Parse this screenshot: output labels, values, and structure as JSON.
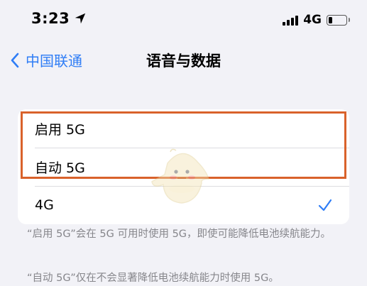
{
  "status_bar": {
    "time": "3:23",
    "network": "4G",
    "icons": [
      "location-arrow-icon",
      "cellular-signal-icon",
      "battery-icon"
    ]
  },
  "nav": {
    "back_label": "中国联通",
    "title": "语音与数据"
  },
  "options": [
    {
      "label": "启用 5G",
      "selected": false
    },
    {
      "label": "自动 5G",
      "selected": false
    },
    {
      "label": "4G",
      "selected": true
    }
  ],
  "notes": [
    "“启用 5G”会在 5G 可用时使用 5G，即使可能降低电池续航能力。",
    "“自动 5G”仅在不会显著降低电池续航能力时使用 5G。"
  ],
  "colors": {
    "accent": "#2f7df6",
    "highlight": "#d9622b",
    "background": "#f2f2f7"
  }
}
